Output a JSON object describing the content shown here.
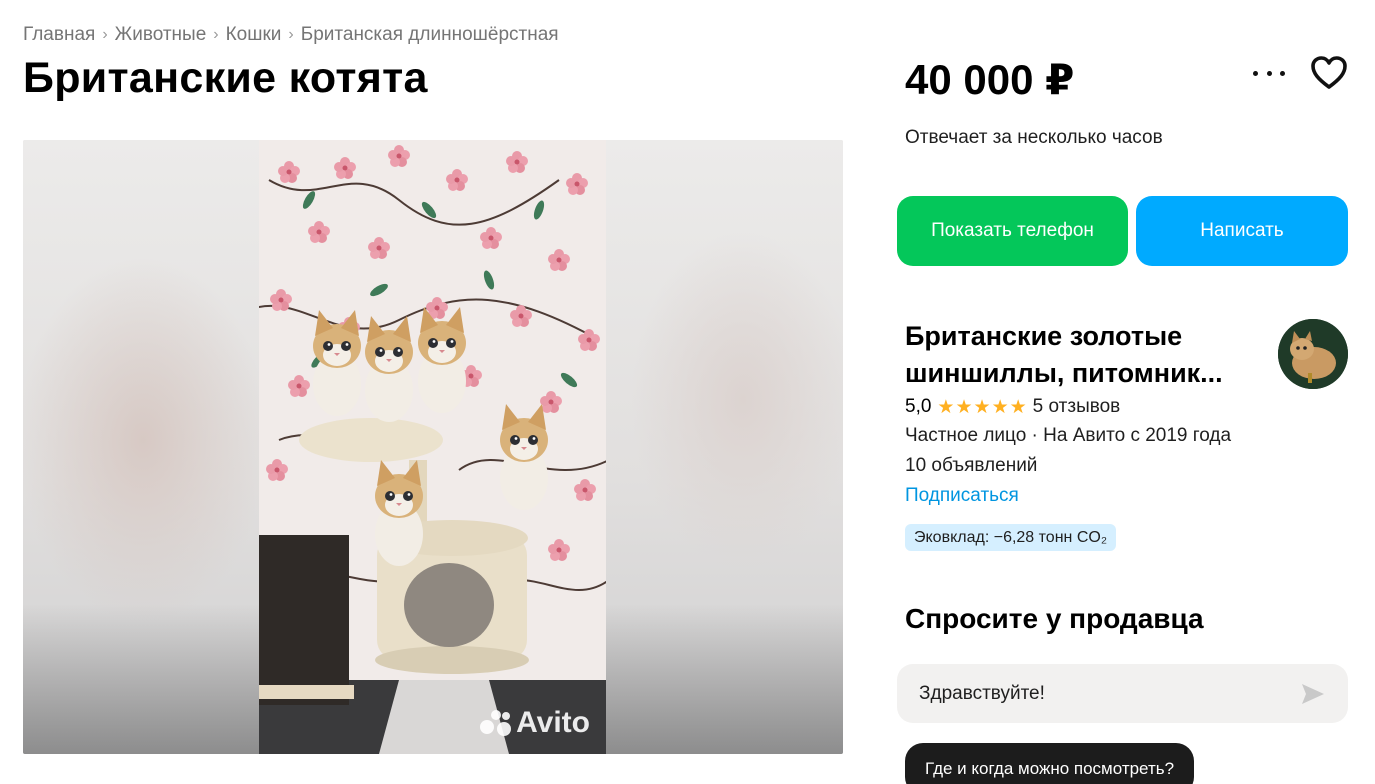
{
  "breadcrumb": {
    "items": [
      "Главная",
      "Животные",
      "Кошки",
      "Британская длинношёрстная"
    ],
    "separator": "›"
  },
  "listing": {
    "title": "Британские котята",
    "price": "40 000 ₽",
    "response_time": "Отвечает за несколько часов"
  },
  "actions": {
    "show_phone": "Показать телефон",
    "write": "Написать",
    "show_phone_color": "#04c75a",
    "write_color": "#00aaff"
  },
  "gallery": {
    "watermark": "Avito"
  },
  "seller": {
    "name": "Британские золотые шиншиллы, питомник...",
    "rating": "5,0",
    "stars": 5,
    "reviews": "5 отзывов",
    "type": "Частное лицо · На Авито с 2019 года",
    "listings": "10 объявлений",
    "subscribe": "Подписаться",
    "eco_badge": "Эковклад: −6,28 тонн CO₂"
  },
  "ask": {
    "title": "Спросите у продавца",
    "message_value": "Здравствуйте!",
    "quick_question": "Где и когда можно посмотреть?"
  },
  "icons": {
    "more": "more-dots-icon",
    "favorite": "heart-icon",
    "send": "send-icon",
    "star": "star-icon"
  }
}
